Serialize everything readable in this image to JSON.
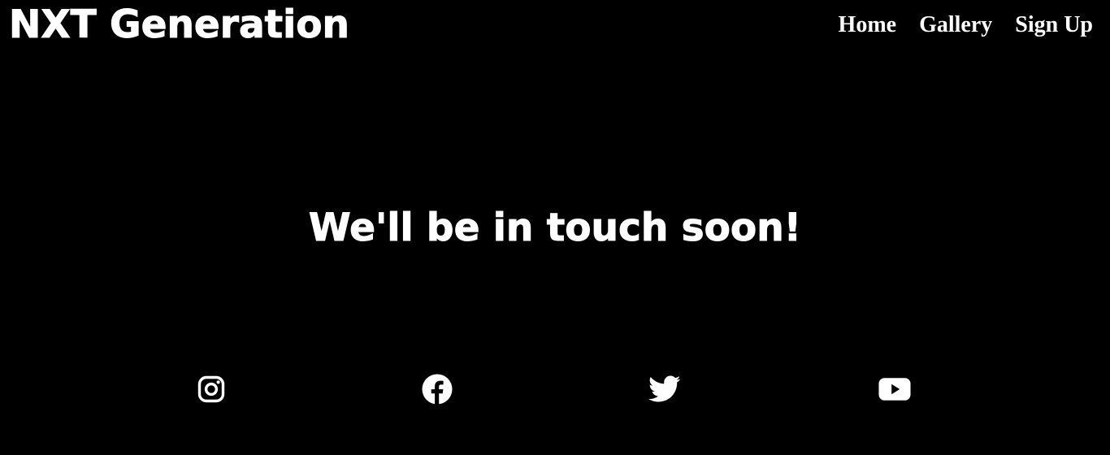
{
  "brand": {
    "title": "NXT Generation"
  },
  "nav": {
    "items": [
      {
        "label": "Home"
      },
      {
        "label": "Gallery"
      },
      {
        "label": "Sign Up"
      }
    ]
  },
  "main": {
    "message": "We'll be in touch soon!"
  },
  "socials": {
    "icons": [
      "instagram-icon",
      "facebook-icon",
      "twitter-icon",
      "youtube-icon"
    ]
  },
  "colors": {
    "background": "#000000",
    "text": "#ffffff"
  }
}
